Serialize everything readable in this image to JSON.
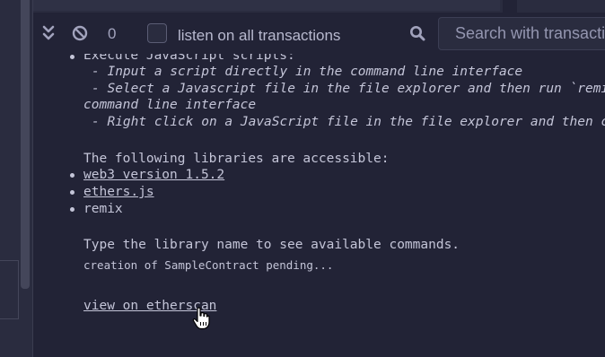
{
  "toolbar": {
    "pending_count": "0",
    "listen_label": "listen on all transactions",
    "search_placeholder": "Search with transactions hash or address"
  },
  "terminal": {
    "scripts_heading": "Execute JavaScript scripts:",
    "script_items": [
      "- Input a script directly in the command line interface",
      "- Select a Javascript file in the file explorer and then run `remix.execute()` or `remix.exe",
      "command line interface",
      "- Right click on a JavaScript file in the file explorer and then click `Run`"
    ],
    "libraries_heading": "The following libraries are accessible:",
    "libraries": [
      {
        "label": "web3 version 1.5.2",
        "link": true
      },
      {
        "label": "ethers.js",
        "link": true
      },
      {
        "label": "remix",
        "link": false
      }
    ],
    "type_hint": "Type the library name to see available commands.",
    "pending_message": "creation of SampleContract pending...",
    "etherscan_link": "view on etherscan"
  },
  "colors": {
    "background": "#222336",
    "panel": "#2a2c3f",
    "text": "#c4c5d8",
    "icon": "#a2a3bd"
  },
  "icons": [
    "double-chevron-down-icon",
    "ban-icon",
    "search-icon",
    "hand-pointer-icon"
  ]
}
